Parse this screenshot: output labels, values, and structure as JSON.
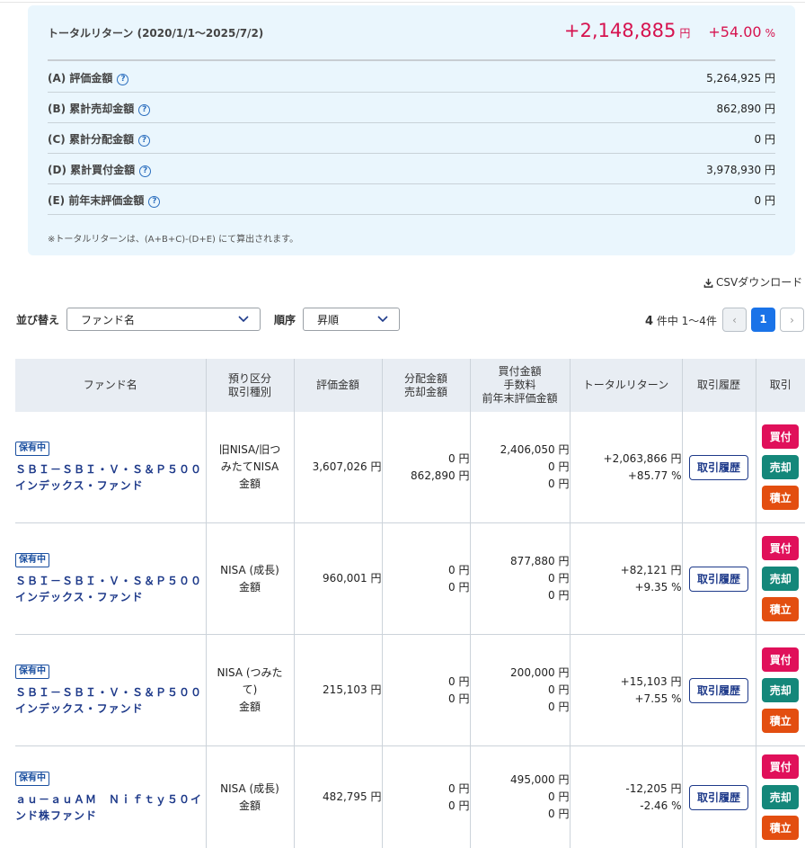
{
  "summary": {
    "title": "トータルリターン (2020/1/1〜2025/7/2)",
    "total_return": "+2,148,885",
    "total_unit": "円",
    "total_pct": "+54.00",
    "pct_unit": "%",
    "rows": [
      {
        "label": "(A) 評価金額",
        "value": "5,264,925 円"
      },
      {
        "label": "(B) 累計売却金額",
        "value": "862,890 円"
      },
      {
        "label": "(C) 累計分配金額",
        "value": "0 円"
      },
      {
        "label": "(D) 累計買付金額",
        "value": "3,978,930 円"
      },
      {
        "label": "(E) 前年末評価金額",
        "value": "0 円"
      }
    ],
    "note": "※トータルリターンは、(A+B+C)-(D+E) にて算出されます。",
    "help_glyph": "?"
  },
  "toolbar": {
    "csv_label": "CSVダウンロード",
    "sort_label": "並び替え",
    "sort_value": "ファンド名",
    "order_label": "順序",
    "order_value": "昇順",
    "count_num": "4",
    "count_text": " 件中 1〜4件",
    "page_prev": "‹",
    "page_current": "1",
    "page_next": "›"
  },
  "table": {
    "headers": {
      "fund": "ファンド名",
      "account_1": "預り区分",
      "account_2": "取引種別",
      "valuation": "評価金額",
      "dist_1": "分配金額",
      "dist_2": "売却金額",
      "buy_1": "買付金額",
      "buy_2": "手数料",
      "buy_3": "前年末評価金額",
      "return": "トータルリターン",
      "history": "取引履歴",
      "trade": "取引"
    },
    "rows": [
      {
        "badge": "保有中",
        "name_1": "ＳＢＩ－ＳＢＩ・Ｖ・Ｓ＆Ｐ５００",
        "name_2": "インデックス・ファンド",
        "acct_1": "旧NISA/旧つ",
        "acct_2": "みたてNISA",
        "acct_3": "金額",
        "valuation": "3,607,026 円",
        "dist": "0 円",
        "sold": "862,890 円",
        "buy": "2,406,050 円",
        "fee": "0 円",
        "prev": "0 円",
        "ret": "+2,063,866 円",
        "ret_pct": "+85.77 %"
      },
      {
        "badge": "保有中",
        "name_1": "ＳＢＩ－ＳＢＩ・Ｖ・Ｓ＆Ｐ５００",
        "name_2": "インデックス・ファンド",
        "acct_1": "NISA (成長)",
        "acct_2": "金額",
        "valuation": "960,001 円",
        "dist": "0 円",
        "sold": "0 円",
        "buy": "877,880 円",
        "fee": "0 円",
        "prev": "0 円",
        "ret": "+82,121 円",
        "ret_pct": "+9.35 %"
      },
      {
        "badge": "保有中",
        "name_1": "ＳＢＩ－ＳＢＩ・Ｖ・Ｓ＆Ｐ５００",
        "name_2": "インデックス・ファンド",
        "acct_1": "NISA (つみた",
        "acct_2": "て)",
        "acct_3": "金額",
        "valuation": "215,103 円",
        "dist": "0 円",
        "sold": "0 円",
        "buy": "200,000 円",
        "fee": "0 円",
        "prev": "0 円",
        "ret": "+15,103 円",
        "ret_pct": "+7.55 %"
      },
      {
        "badge": "保有中",
        "name_1": "ａｕ－ａｕＡＭ　Ｎｉｆｔｙ５０イ",
        "name_2": "ンド株ファンド",
        "acct_1": "NISA (成長)",
        "acct_2": "金額",
        "valuation": "482,795 円",
        "dist": "0 円",
        "sold": "0 円",
        "buy": "495,000 円",
        "fee": "0 円",
        "prev": "0 円",
        "ret": "-12,205 円",
        "ret_pct": "-2.46 %"
      }
    ],
    "history_label": "取引履歴",
    "buy_label": "買付",
    "sell_label": "売却",
    "accum_label": "積立"
  },
  "colors": {
    "positive": "#d6134f",
    "negative": "#1a8a7e",
    "accent": "#1a73e8"
  },
  "icons": [
    "help-circle-icon",
    "download-icon",
    "chevron-down-icon",
    "chevron-left-icon",
    "chevron-right-icon"
  ]
}
